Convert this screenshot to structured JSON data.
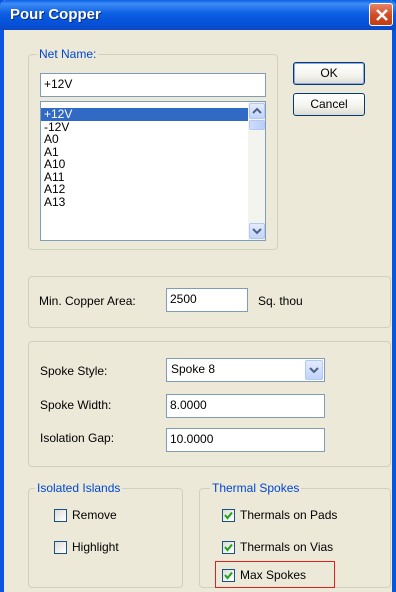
{
  "window": {
    "title": "Pour Copper"
  },
  "net_name": {
    "group_label": "Net Name:",
    "value": "+12V",
    "list_items": [
      "+12V",
      "-12V",
      "A0",
      "A1",
      "A10",
      "A11",
      "A12",
      "A13"
    ],
    "selected": "+12V"
  },
  "buttons": {
    "ok": "OK",
    "cancel": "Cancel"
  },
  "min_copper": {
    "label": "Min. Copper Area:",
    "value": "2500",
    "unit": "Sq. thou"
  },
  "spokes": {
    "style_label": "Spoke Style:",
    "style_value": "Spoke 8",
    "width_label": "Spoke Width:",
    "width_value": "8.0000",
    "gap_label": "Isolation Gap:",
    "gap_value": "10.0000"
  },
  "isolated_islands": {
    "group_label": "Isolated Islands",
    "remove": {
      "label": "Remove",
      "checked": false
    },
    "highlight": {
      "label": "Highlight",
      "checked": false
    }
  },
  "thermal_spokes": {
    "group_label": "Thermal Spokes",
    "pads": {
      "label": "Thermals on Pads",
      "checked": true
    },
    "vias": {
      "label": "Thermals on Vias",
      "checked": true
    },
    "max": {
      "label": "Max Spokes",
      "checked": true
    }
  },
  "colors": {
    "title_bar": "#0a54e2",
    "face": "#ece9d8",
    "group_label": "#0046d5",
    "selection": "#316ac5",
    "highlight": "#e0201c"
  }
}
